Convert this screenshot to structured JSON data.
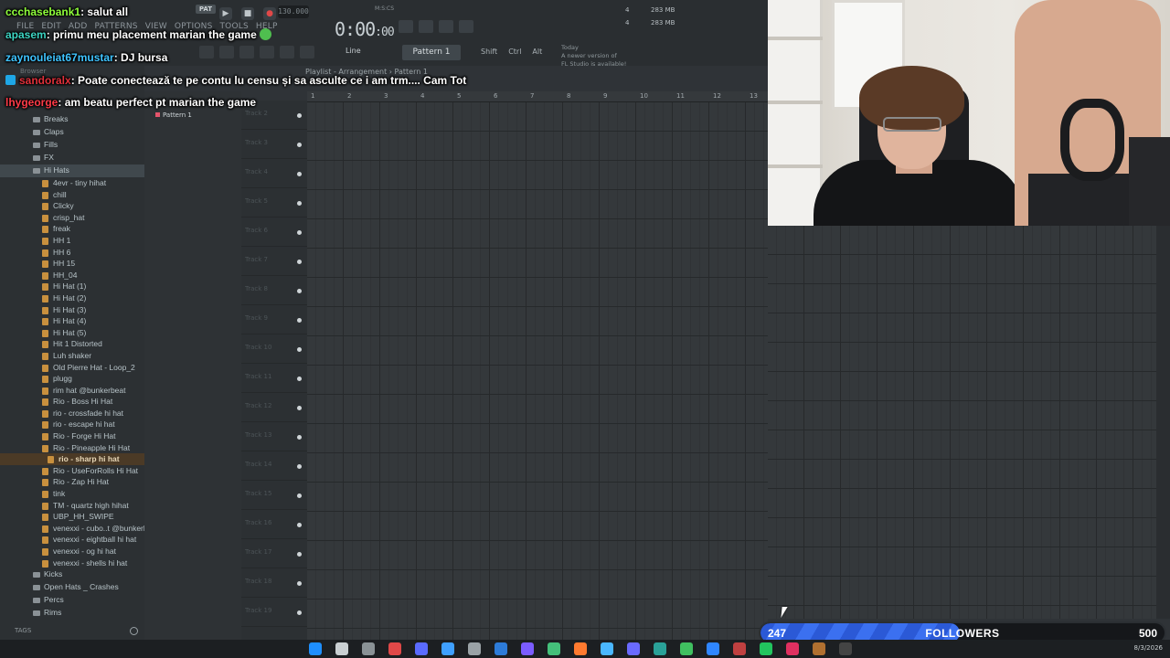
{
  "app": {
    "menu": [
      "FILE",
      "EDIT",
      "ADD",
      "PATTERNS",
      "VIEW",
      "OPTIONS",
      "TOOLS",
      "HELP"
    ],
    "pat_tag": "PAT",
    "tempo": "130.000",
    "time_main": "0:00",
    "time_sub": ":00",
    "time_unit": "M:S:CS",
    "cpu": [
      "4",
      "4"
    ],
    "memory": [
      "283 MB",
      "283 MB"
    ],
    "snap_label": "Line",
    "pattern": "Pattern 1",
    "modifiers": [
      "Shift",
      "Ctrl",
      "Alt"
    ],
    "news": [
      "Today",
      "A newer version of",
      "FL Studio is available!"
    ]
  },
  "browser": {
    "header": "Browser",
    "tags_label": "TAGS",
    "folders_top": [
      "Breaks",
      "Claps",
      "Fills",
      "FX"
    ],
    "open_folder": "Hi Hats",
    "files": [
      "4evr - tiny hihat",
      "chill",
      "Clicky",
      "crisp_hat",
      "freak",
      "HH 1",
      "HH 6",
      "HH 15",
      "HH_04",
      "Hi Hat (1)",
      "Hi Hat (2)",
      "Hi Hat (3)",
      "Hi Hat (4)",
      "Hi Hat (5)",
      "Hit 1 Distorted",
      "Luh shaker",
      "Old Pierre Hat - Loop_2",
      "plugg",
      "rim hat @bunkerbeat",
      "Rio - Boss Hi Hat",
      "rio - crossfade hi hat",
      "rio - escape hi hat",
      "Rio - Forge Hi Hat",
      "Rio - Pineapple Hi Hat",
      "rio - sharp hi hat",
      "Rio - UseForRolls Hi Hat",
      "Rio - Zap Hi Hat",
      "tink",
      "TM - quartz high hihat",
      "UBP_HH_SWIPE",
      "venexxi - cubo..t @bunkerbeat",
      "venexxi - eightball hi hat",
      "venexxi - og hi hat",
      "venexxi - shells hi hat"
    ],
    "highlighted_file": "rio - sharp hi hat",
    "folders_bottom": [
      "Kicks",
      "Open Hats _ Crashes",
      "Percs",
      "Rims"
    ]
  },
  "playlist": {
    "title": "Playlist - Arrangement",
    "title_pattern": "Pattern 1",
    "pattern_item": "Pattern 1",
    "bars": [
      "1",
      "2",
      "3",
      "4",
      "5",
      "6",
      "7",
      "8",
      "9",
      "10",
      "11",
      "12",
      "13"
    ],
    "tracks": [
      "Track 2",
      "Track 3",
      "Track 4",
      "Track 5",
      "Track 6",
      "Track 7",
      "Track 8",
      "Track 9",
      "Track 10",
      "Track 11",
      "Track 12",
      "Track 13",
      "Track 14",
      "Track 15",
      "Track 16",
      "Track 17",
      "Track 18",
      "Track 19"
    ]
  },
  "chat": [
    {
      "user": "ccchasebank1",
      "text": ": salut all",
      "color": "#8fff3b"
    },
    {
      "user": "apasem",
      "text": ": primu meu placement marian the game",
      "color": "#3dd6c4",
      "emote": true
    },
    {
      "user": "zaynouleiat67mustar",
      "text": ": DJ bursa",
      "color": "#3fc4ff"
    },
    {
      "user": "sandoralx",
      "text": ": Poate conectează te pe contu lu censu și sa asculte ce i am trm.... Cam Tot",
      "color": "#e0303a",
      "badge": true
    },
    {
      "user": "lhygeorge",
      "text": ": am beatu perfect pt marian the game",
      "color": "#ff3b48"
    }
  ],
  "goal": {
    "current": "247",
    "label": "FOLLOWERS",
    "target": "500",
    "progress": 0.494,
    "color": "#2b59d6"
  },
  "taskbar": {
    "date": "8/3/2026",
    "icons": [
      "windows-icon",
      "search-icon",
      "taskview-icon",
      "app-icon",
      "app-icon",
      "app-icon",
      "app-icon",
      "app-icon",
      "app-icon",
      "app-icon",
      "app-icon",
      "app-icon",
      "app-icon",
      "app-icon",
      "app-icon",
      "app-icon",
      "app-icon",
      "app-icon",
      "app-icon",
      "app-icon",
      "app-icon"
    ]
  }
}
